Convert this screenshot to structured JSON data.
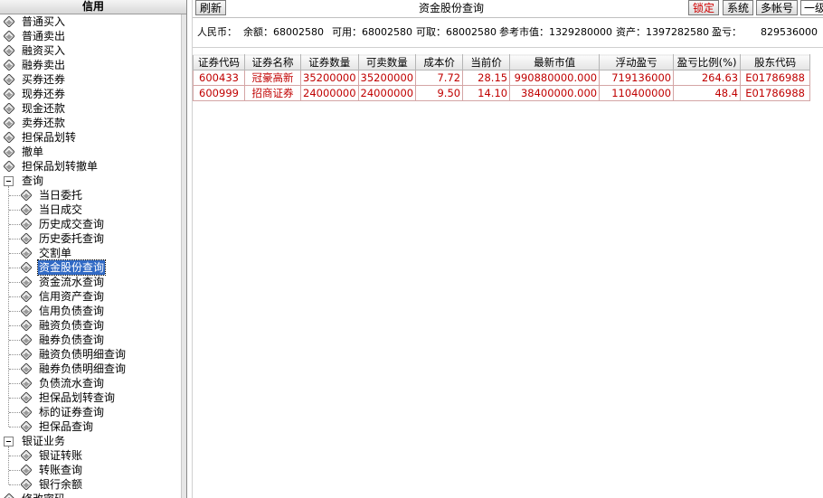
{
  "sidebar": {
    "title": "信用",
    "items": [
      {
        "label": "普通买入",
        "type": "top"
      },
      {
        "label": "普通卖出",
        "type": "top"
      },
      {
        "label": "融资买入",
        "type": "top"
      },
      {
        "label": "融券卖出",
        "type": "top"
      },
      {
        "label": "买券还券",
        "type": "top"
      },
      {
        "label": "现券还券",
        "type": "top"
      },
      {
        "label": "现金还款",
        "type": "top"
      },
      {
        "label": "卖券还款",
        "type": "top"
      },
      {
        "label": "担保品划转",
        "type": "top"
      },
      {
        "label": "撤单",
        "type": "top"
      },
      {
        "label": "担保品划转撤单",
        "type": "top"
      },
      {
        "label": "查询",
        "type": "group"
      },
      {
        "label": "当日委托",
        "type": "child"
      },
      {
        "label": "当日成交",
        "type": "child"
      },
      {
        "label": "历史成交查询",
        "type": "child"
      },
      {
        "label": "历史委托查询",
        "type": "child"
      },
      {
        "label": "交割单",
        "type": "child"
      },
      {
        "label": "资金股份查询",
        "type": "child",
        "selected": true
      },
      {
        "label": "资金流水查询",
        "type": "child"
      },
      {
        "label": "信用资产查询",
        "type": "child"
      },
      {
        "label": "信用负债查询",
        "type": "child"
      },
      {
        "label": "融资负债查询",
        "type": "child"
      },
      {
        "label": "融券负债查询",
        "type": "child"
      },
      {
        "label": "融资负债明细查询",
        "type": "child"
      },
      {
        "label": "融券负债明细查询",
        "type": "child"
      },
      {
        "label": "负债流水查询",
        "type": "child"
      },
      {
        "label": "担保品划转查询",
        "type": "child"
      },
      {
        "label": "标的证券查询",
        "type": "child"
      },
      {
        "label": "担保品查询",
        "type": "child"
      },
      {
        "label": "银证业务",
        "type": "group"
      },
      {
        "label": "银证转账",
        "type": "child"
      },
      {
        "label": "转账查询",
        "type": "child"
      },
      {
        "label": "银行余额",
        "type": "child"
      },
      {
        "label": "修改密码",
        "type": "top"
      }
    ]
  },
  "toolbar": {
    "refresh_label": "刷新",
    "title": "资金股份查询",
    "lock_label": "锁定",
    "system_label": "系统",
    "multi_account_label": "多帐号",
    "level_value": "一级"
  },
  "summary": {
    "currency": "人民币：",
    "balance": "余额：68002580",
    "available": "可用：68002580",
    "withdrawable": "可取：68002580",
    "market_value": "参考市值：1329280000",
    "assets": "资产：1397282580",
    "pnl_label": "盈亏：",
    "pnl_value": "829536000"
  },
  "table": {
    "columns": [
      "证券代码",
      "证券名称",
      "证券数量",
      "可卖数量",
      "成本价",
      "当前价",
      "最新市值",
      "浮动盈亏",
      "盈亏比例(%)",
      "股东代码"
    ],
    "rows": [
      [
        "600433",
        "冠豪高新",
        "35200000",
        "35200000",
        "7.72",
        "28.15",
        "990880000.000",
        "719136000",
        "264.63",
        "E01786988"
      ],
      [
        "600999",
        "招商证券",
        "24000000",
        "24000000",
        "9.50",
        "14.10",
        "38400000.000",
        "110400000",
        "48.4",
        "E01786988"
      ]
    ]
  },
  "colors": {
    "row_text": "#c00000",
    "selection": "#316ac5",
    "lock_text": "#d00000"
  },
  "icons": {
    "tree_item": "diamond-arrow-icon",
    "collapse": "minus-box-icon"
  }
}
